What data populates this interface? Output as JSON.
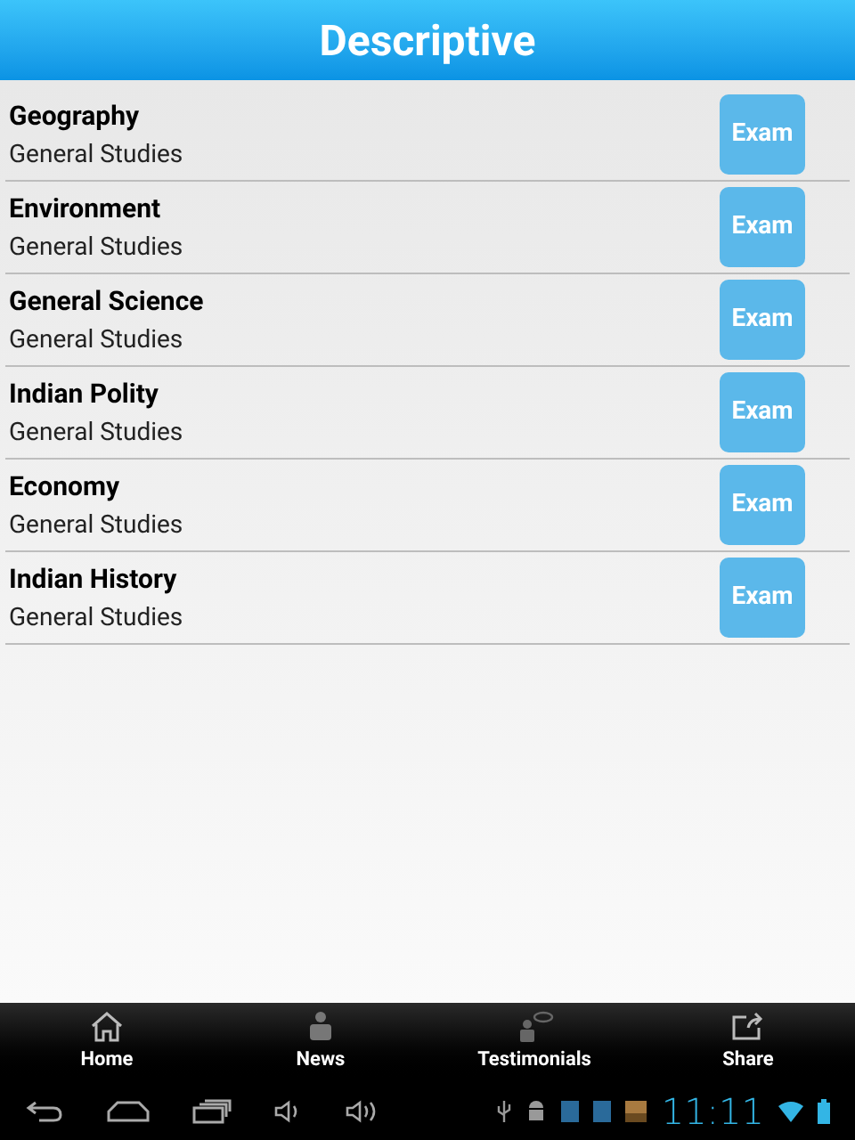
{
  "header": {
    "title": "Descriptive"
  },
  "items": [
    {
      "title": "Geography",
      "subtitle": "General Studies",
      "button": "Exam"
    },
    {
      "title": "Environment",
      "subtitle": "General Studies",
      "button": "Exam"
    },
    {
      "title": "General Science",
      "subtitle": "General Studies",
      "button": "Exam"
    },
    {
      "title": "Indian Polity",
      "subtitle": "General Studies",
      "button": "Exam"
    },
    {
      "title": "Economy",
      "subtitle": "General Studies",
      "button": "Exam"
    },
    {
      "title": "Indian History",
      "subtitle": "General Studies",
      "button": "Exam"
    }
  ],
  "tab_bar": [
    {
      "label": "Home",
      "kind": "home"
    },
    {
      "label": "News",
      "kind": "news"
    },
    {
      "label": "Testimonials",
      "kind": "testimonials"
    },
    {
      "label": "Share",
      "kind": "share"
    }
  ],
  "system_bar": {
    "time": "11:11"
  }
}
